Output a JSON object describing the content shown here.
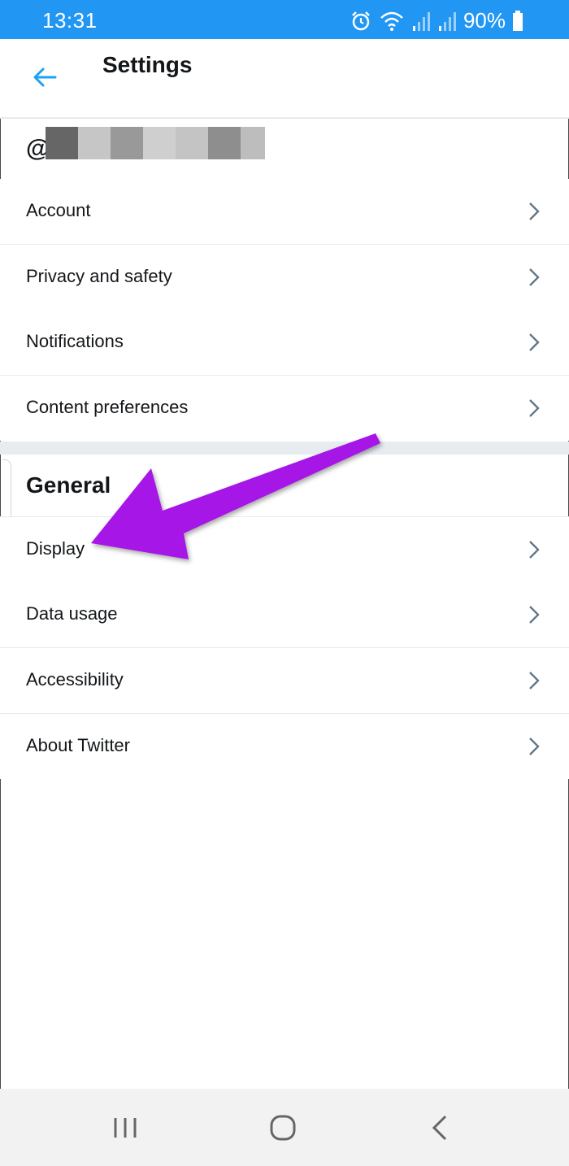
{
  "status_bar": {
    "time": "13:31",
    "battery": "90%",
    "background_color": "#2196f3",
    "icons": [
      "alarm-icon",
      "wifi-icon",
      "signal-icon",
      "signal-icon-2",
      "battery-icon"
    ]
  },
  "header": {
    "title": "Settings",
    "back_icon": "arrow-left-icon",
    "accent_color": "#1da1f2"
  },
  "account": {
    "username_prefix": "@"
  },
  "settings_items": [
    {
      "label": "Account"
    },
    {
      "label": "Privacy and safety"
    },
    {
      "label": "Notifications"
    },
    {
      "label": "Content preferences"
    }
  ],
  "general": {
    "header": "General",
    "items": [
      {
        "label": "Display"
      },
      {
        "label": "Data usage"
      },
      {
        "label": "Accessibility"
      },
      {
        "label": "About Twitter"
      }
    ]
  },
  "annotation": {
    "arrow_color": "#a613e6"
  },
  "nav_bar": {
    "buttons": [
      "recent-apps-icon",
      "home-icon",
      "back-icon"
    ]
  }
}
